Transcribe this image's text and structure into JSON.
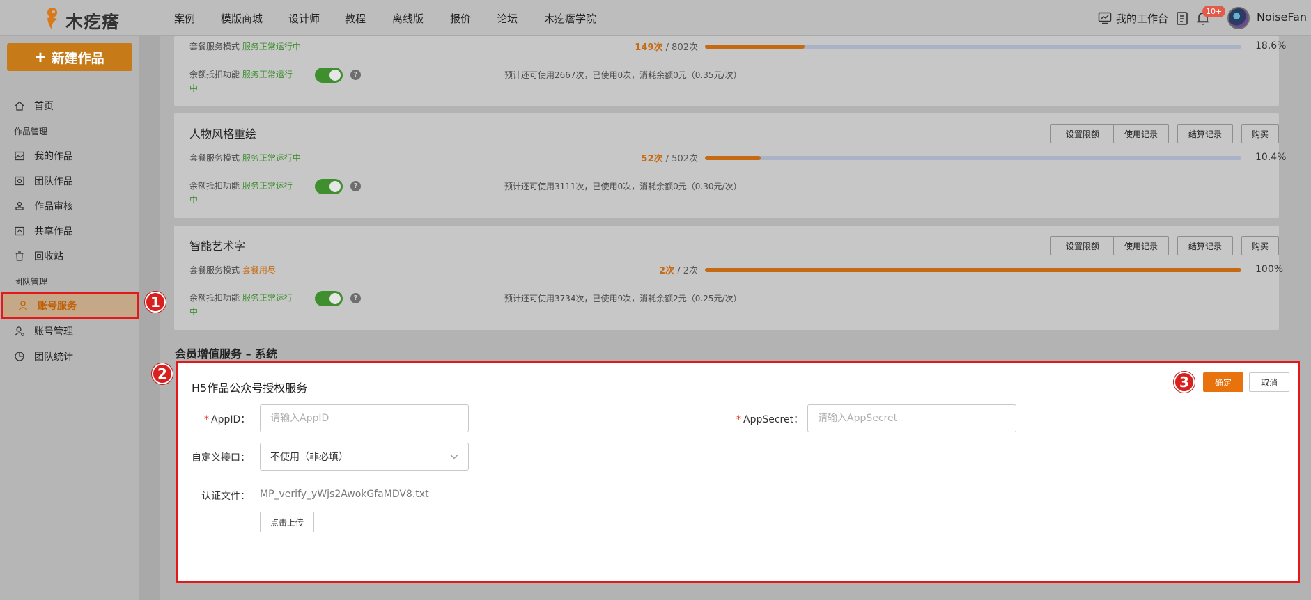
{
  "brand": {
    "logo_text": "木疙瘩",
    "accent": "#e8720c"
  },
  "nav": {
    "items": [
      "案例",
      "模版商城",
      "设计师",
      "教程",
      "离线版",
      "报价",
      "论坛",
      "木疙瘩学院"
    ]
  },
  "header": {
    "workbench_label": "我的工作台",
    "notification_badge": "10+",
    "username": "NoiseFan",
    "icons": [
      "monitor-icon",
      "clipboard-icon",
      "bell-icon"
    ]
  },
  "sidebar": {
    "new_button": "新建作品",
    "home": "首页",
    "group_works": "作品管理",
    "my_works": "我的作品",
    "team_works": "团队作品",
    "review": "作品审核",
    "shared": "共享作品",
    "recycle": "回收站",
    "group_team": "团队管理",
    "account_service": "账号服务",
    "account_manage": "账号管理",
    "team_stats": "团队统计"
  },
  "markers": [
    "1",
    "2",
    "3"
  ],
  "common": {
    "package_mode_label": "套餐服务模式",
    "running_status": "服务正常运行中",
    "balance_label": "余额抵扣功能",
    "help_glyph": "?",
    "btn_limit": "设置限额",
    "btn_usage_log": "使用记录",
    "btn_settle_log": "结算记录",
    "btn_buy": "购买"
  },
  "services": [
    {
      "name": "",
      "package_status": "服务正常运行中",
      "used": "149次",
      "total": " / 802次",
      "progress": 18.6,
      "percent_text": "18.6%",
      "balance_status_a": "服务正常运行",
      "balance_status_b": "中",
      "estimate": "预计还可使用2667次，已使用0次，消耗余额0元（0.35元/次）"
    },
    {
      "name": "人物风格重绘",
      "package_status": "服务正常运行中",
      "used": "52次",
      "total": " / 502次",
      "progress": 10.4,
      "percent_text": "10.4%",
      "balance_status_a": "服务正常运行",
      "balance_status_b": "中",
      "estimate": "预计还可使用3111次，已使用0次，消耗余额0元（0.30元/次）"
    },
    {
      "name": "智能艺术字",
      "package_status": "套餐用尽",
      "used": "2次",
      "total": " / 2次",
      "progress": 100,
      "percent_text": "100%",
      "balance_status_a": "服务正常运行",
      "balance_status_b": "中",
      "estimate": "预计还可使用3734次，已使用9次，消耗余额2元（0.25元/次）"
    }
  ],
  "section_title": "会员增值服务 – 系统",
  "form": {
    "title": "H5作品公众号授权服务",
    "confirm": "确定",
    "cancel": "取消",
    "required_mark": "*",
    "appid_label": "AppID：",
    "appid_placeholder": "请输入AppID",
    "appsecret_label": "AppSecret：",
    "appsecret_placeholder": "请输入AppSecret",
    "custom_api_label": "自定义接口：",
    "custom_api_value": "不使用（非必填）",
    "cert_label": "认证文件：",
    "cert_file": "MP_verify_yWjs2AwokGfaMDV8.txt",
    "upload_button": "点击上传"
  }
}
